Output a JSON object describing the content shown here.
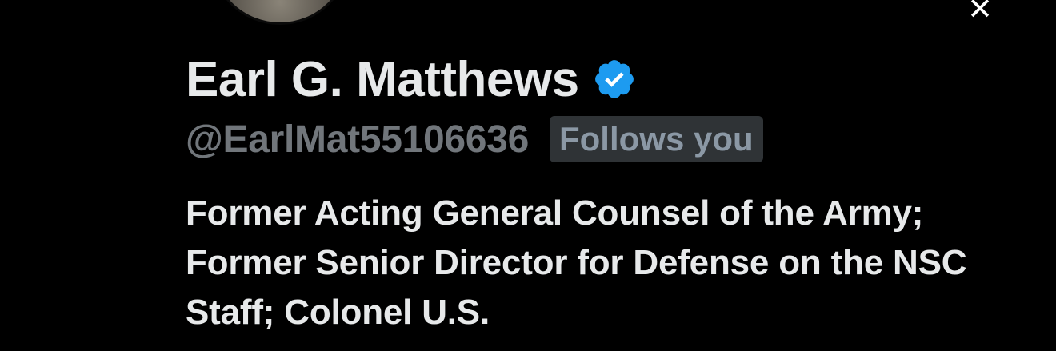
{
  "profile": {
    "display_name": "Earl G. Matthews",
    "handle": "@EarlMat55106636",
    "follows_badge": "Follows you",
    "verified": true,
    "bio": "Former Acting General Counsel of the Army; Former Senior Director for Defense on the NSC Staff; Colonel U.S."
  },
  "icons": {
    "close": "close-icon",
    "verified": "verified-badge-icon",
    "avatar": "profile-avatar"
  },
  "colors": {
    "background": "#000000",
    "text_primary": "#e7e9ea",
    "text_secondary": "#71767b",
    "verified_blue": "#1d9bf0",
    "badge_background": "#2f3336"
  }
}
